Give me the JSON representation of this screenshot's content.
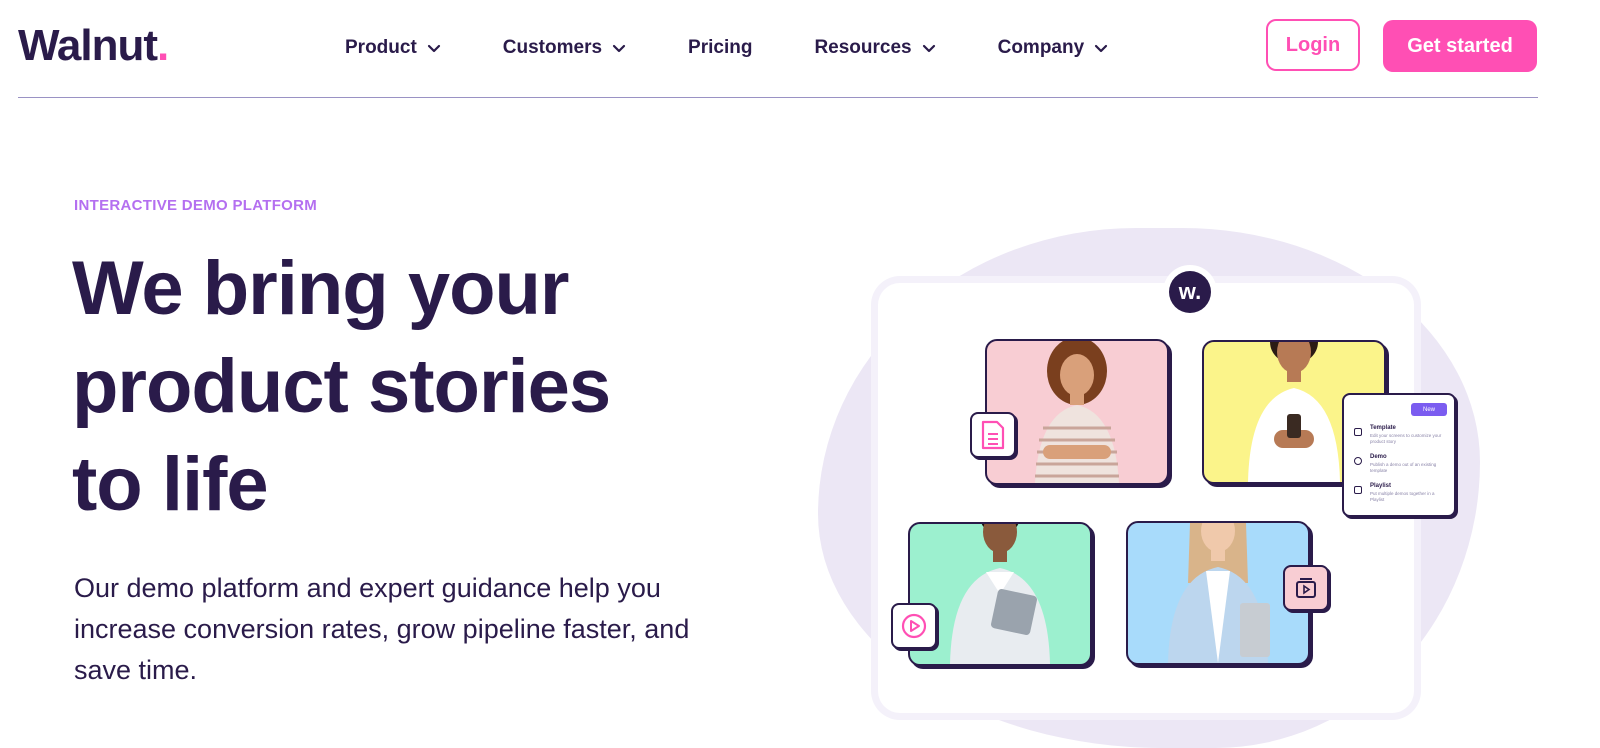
{
  "brand": {
    "name": "Walnut",
    "dot": ".",
    "accent": "#ff4fb4",
    "ink": "#2a1b4a"
  },
  "nav": {
    "items": [
      {
        "label": "Product",
        "has_dropdown": true
      },
      {
        "label": "Customers",
        "has_dropdown": true
      },
      {
        "label": "Pricing",
        "has_dropdown": false
      },
      {
        "label": "Resources",
        "has_dropdown": true
      },
      {
        "label": "Company",
        "has_dropdown": true
      }
    ],
    "login_label": "Login",
    "cta_label": "Get started"
  },
  "hero": {
    "eyebrow": "INTERACTIVE DEMO PLATFORM",
    "headline_lines": [
      "We bring your",
      "product stories",
      "to life"
    ],
    "subtext": "Our demo platform and expert guidance help you increase conversion rates, grow pipeline faster, and save time."
  },
  "illustration": {
    "badge": "w.",
    "panel": {
      "new_label": "New",
      "rows": [
        {
          "title": "Template",
          "desc": "Edit your screens to customize your product story"
        },
        {
          "title": "Demo",
          "desc": "Publish a demo out of an existing template"
        },
        {
          "title": "Playlist",
          "desc": "Put multiple demos together in a Playlist"
        }
      ]
    },
    "card_colors": [
      "#f8cdd3",
      "#fbf48a",
      "#9cf0cf",
      "#a8dbfb"
    ]
  }
}
